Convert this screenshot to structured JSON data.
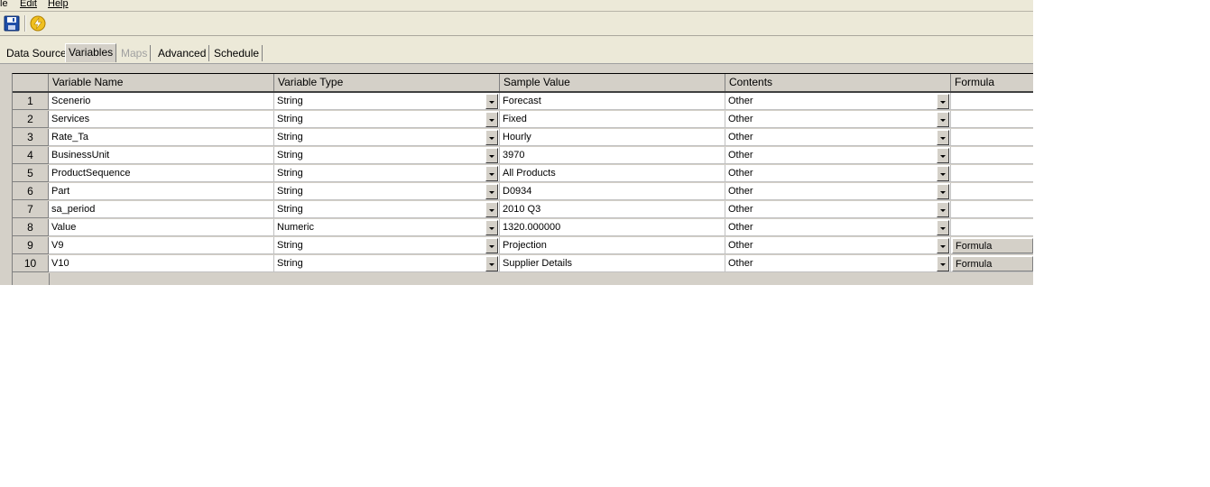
{
  "menu": {
    "file_tail": "le",
    "edit": "Edit",
    "help": "Help"
  },
  "toolbar": {
    "save_icon": "floppy-disk-icon",
    "run_icon": "lightning-bolt-icon",
    "save_color": "#1f4ea8",
    "run_color": "#f0c020"
  },
  "tabs": [
    {
      "label": "Data Source",
      "state": "normal"
    },
    {
      "label": "Variables",
      "state": "active"
    },
    {
      "label": "Maps",
      "state": "disabled"
    },
    {
      "label": "Advanced",
      "state": "normal"
    },
    {
      "label": "Schedule",
      "state": "normal"
    }
  ],
  "grid": {
    "headers": {
      "name": "Variable Name",
      "type": "Variable Type",
      "sample": "Sample Value",
      "contents": "Contents",
      "formula": "Formula"
    },
    "rows": [
      {
        "num": "1",
        "name": "Scenerio",
        "type": "String",
        "sample": "Forecast",
        "contents": "Other",
        "formula": ""
      },
      {
        "num": "2",
        "name": "Services",
        "type": "String",
        "sample": "Fixed",
        "contents": "Other",
        "formula": ""
      },
      {
        "num": "3",
        "name": "Rate_Ta",
        "type": "String",
        "sample": "Hourly",
        "contents": "Other",
        "formula": ""
      },
      {
        "num": "4",
        "name": "BusinessUnit",
        "type": "String",
        "sample": "3970",
        "contents": "Other",
        "formula": ""
      },
      {
        "num": "5",
        "name": "ProductSequence",
        "type": "String",
        "sample": "All Products",
        "contents": "Other",
        "formula": ""
      },
      {
        "num": "6",
        "name": "Part",
        "type": "String",
        "sample": "D0934",
        "contents": "Other",
        "formula": ""
      },
      {
        "num": "7",
        "name": "sa_period",
        "type": "String",
        "sample": "2010 Q3",
        "contents": "Other",
        "formula": ""
      },
      {
        "num": "8",
        "name": "Value",
        "type": "Numeric",
        "sample": "1320.000000",
        "contents": "Other",
        "formula": ""
      },
      {
        "num": "9",
        "name": "V9",
        "type": "String",
        "sample": "Projection",
        "contents": "Other",
        "formula": "Formula"
      },
      {
        "num": "10",
        "name": "V10",
        "type": "String",
        "sample": "Supplier Details",
        "contents": "Other",
        "formula": "Formula"
      }
    ]
  }
}
